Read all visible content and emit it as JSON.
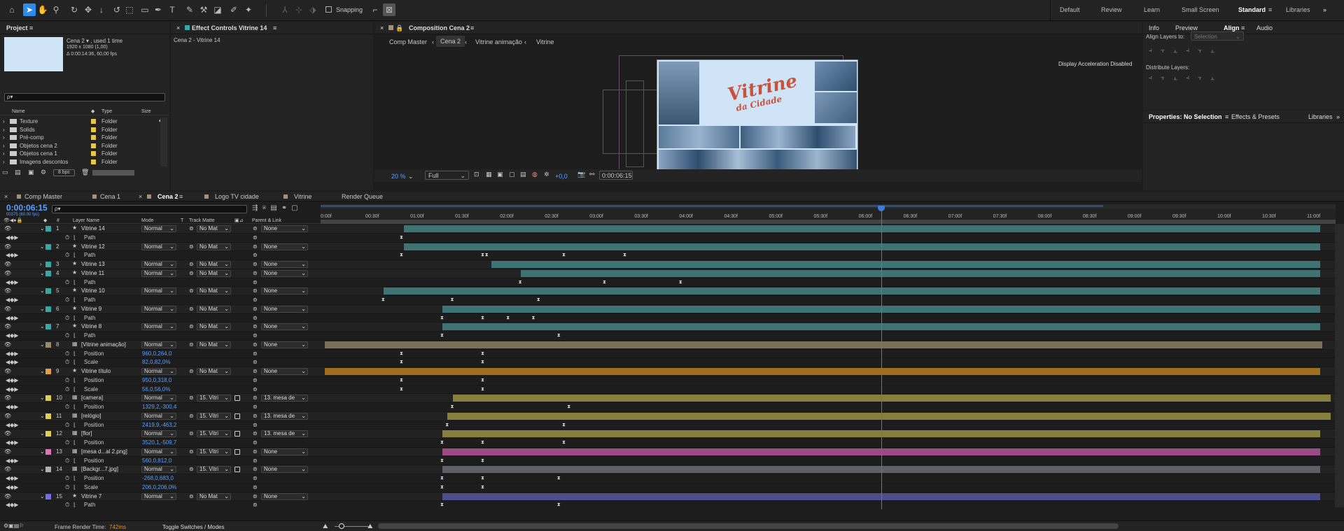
{
  "toolbar": {
    "snapping_label": "Snapping",
    "workspaces": [
      "Default",
      "Review",
      "Learn",
      "Small Screen",
      "Standard",
      "Libraries"
    ],
    "active_workspace": "Standard"
  },
  "project": {
    "title": "Project",
    "comp_name": "Cena 2 ▾ , used 1 time",
    "comp_size": "1920 x 1080 (1,00)",
    "comp_duration": "Δ 0:00:14:36, 60,00 fps",
    "search_placeholder": "ρ▾",
    "columns": [
      "Name",
      "Type",
      "Size"
    ],
    "items": [
      {
        "name": "Texture",
        "type": "Folder"
      },
      {
        "name": "Solids",
        "type": "Folder"
      },
      {
        "name": "Pré-comp",
        "type": "Folder"
      },
      {
        "name": "Objetos cena 2",
        "type": "Folder"
      },
      {
        "name": "Objetos cena 1",
        "type": "Folder"
      },
      {
        "name": "Imagens descontos",
        "type": "Folder"
      }
    ],
    "bpc": "8 bpc"
  },
  "effect_controls": {
    "title": "Effect Controls Vitrine 14",
    "subtitle": "Cena 2 - Vitrine 14"
  },
  "composition": {
    "title": "Composition Cena 2",
    "breadcrumbs": [
      "Comp Master",
      "Cena 2",
      "Vitrine animação",
      "Vitrine"
    ],
    "active_breadcrumb": "Cena 2",
    "display_msg": "Display Acceleration Disabled",
    "zoom": "20 %",
    "resolution": "Full",
    "exposure": "+0,0",
    "timecode": "0:00:06:15",
    "art_title": "Vitrine",
    "art_sub": "da Cidade"
  },
  "right": {
    "tabs": [
      "Info",
      "Preview",
      "Align",
      "Audio"
    ],
    "active_tab": "Align",
    "align_to_label": "Align Layers to:",
    "align_to_value": "Selection",
    "distribute_label": "Distribute Layers:",
    "props_tabs": [
      "Properties: No Selection",
      "Effects & Presets",
      "Libraries"
    ]
  },
  "timeline": {
    "tabs": [
      "Comp Master",
      "Cena 1",
      "Cena 2",
      "Logo TV cidade",
      "Vitrine",
      "Render Queue"
    ],
    "active_tab": "Cena 2",
    "timecode": "0:00:06:15",
    "frame_info": "00375 (60.00 fps)",
    "search_placeholder": "ρ▾",
    "col_headers": {
      "num": "#",
      "layer": "Layer Name",
      "mode": "Mode",
      "t": "T",
      "matte": "Track Matte",
      "parent": "Parent & Link"
    },
    "ruler": [
      "0:00f",
      "00:30f",
      "01:00f",
      "01:30f",
      "02:00f",
      "02:30f",
      "03:00f",
      "03:30f",
      "04:00f",
      "04:30f",
      "05:00f",
      "05:30f",
      "06:00f",
      "06:30f",
      "07:00f",
      "07:30f",
      "08:00f",
      "08:30f",
      "09:00f",
      "09:30f",
      "10:00f",
      "10:30f",
      "11:00f"
    ],
    "footer_render_label": "Frame Render Time:",
    "footer_render_value": "742ms",
    "footer_toggle": "Toggle Switches / Modes",
    "rows": [
      {
        "n": "1",
        "name": "Vitrine 14",
        "kind": "layer",
        "icon": "★",
        "color": "#3aa6a6",
        "mode": "Normal",
        "matte": "No Mat",
        "parent": "None",
        "bar": "#3f7272",
        "bs": 0.082,
        "be": 0.985
      },
      {
        "name": "Path",
        "kind": "prop",
        "value": "",
        "kf": [
          0.08
        ]
      },
      {
        "n": "2",
        "name": "Vitrine 12",
        "kind": "layer",
        "icon": "★",
        "color": "#3aa6a6",
        "mode": "Normal",
        "matte": "No Mat",
        "parent": "None",
        "bar": "#3f7272",
        "bs": 0.082,
        "be": 0.985
      },
      {
        "name": "Path",
        "kind": "prop",
        "value": "",
        "kf": [
          0.08,
          0.16,
          0.164,
          0.24,
          0.3
        ]
      },
      {
        "n": "3",
        "name": "Vitrine 13",
        "kind": "layer",
        "icon": "★",
        "color": "#3aa6a6",
        "mode": "Normal",
        "matte": "No Mat",
        "parent": "None",
        "bar": "#3f7272",
        "bs": 0.168,
        "be": 0.985,
        "collapsed": true
      },
      {
        "n": "4",
        "name": "Vitrine 11",
        "kind": "layer",
        "icon": "★",
        "color": "#3aa6a6",
        "mode": "Normal",
        "matte": "No Mat",
        "parent": "None",
        "bar": "#3f7272",
        "bs": 0.197,
        "be": 0.985
      },
      {
        "name": "Path",
        "kind": "prop",
        "value": "",
        "kf": [
          0.197,
          0.28,
          0.355
        ]
      },
      {
        "n": "5",
        "name": "Vitrine 10",
        "kind": "layer",
        "icon": "★",
        "color": "#3aa6a6",
        "mode": "Normal",
        "matte": "No Mat",
        "parent": "None",
        "bar": "#3f7272",
        "bs": 0.062,
        "be": 0.985
      },
      {
        "name": "Path",
        "kind": "prop",
        "value": "",
        "kf": [
          0.062,
          0.13,
          0.215
        ]
      },
      {
        "n": "6",
        "name": "Vitrine 9",
        "kind": "layer",
        "icon": "★",
        "color": "#3aa6a6",
        "mode": "Normal",
        "matte": "No Mat",
        "parent": "None",
        "bar": "#3f7272",
        "bs": 0.12,
        "be": 0.985
      },
      {
        "name": "Path",
        "kind": "prop",
        "value": "",
        "kf": [
          0.12,
          0.16,
          0.185,
          0.21
        ]
      },
      {
        "n": "7",
        "name": "Vitrine 8",
        "kind": "layer",
        "icon": "★",
        "color": "#3aa6a6",
        "mode": "Normal",
        "matte": "No Mat",
        "parent": "None",
        "bar": "#3f7272",
        "bs": 0.12,
        "be": 0.985
      },
      {
        "name": "Path",
        "kind": "prop",
        "value": "",
        "kf": [
          0.12,
          0.235
        ]
      },
      {
        "n": "8",
        "name": "[Vitrine animação]",
        "kind": "layer",
        "icon": "▦",
        "color": "#9c8a66",
        "mode": "Normal",
        "matte": "No Mat",
        "parent": "None",
        "bar": "#7b6f58",
        "bs": 0.004,
        "be": 0.987
      },
      {
        "name": "Position",
        "kind": "prop",
        "value": "960,0,264,0",
        "kf": [
          0.08,
          0.16
        ]
      },
      {
        "name": "Scale",
        "kind": "prop",
        "value": "82,0,82,0%",
        "kf": [
          0.08,
          0.16
        ]
      },
      {
        "n": "9",
        "name": "Vitrine título",
        "kind": "layer",
        "icon": "★",
        "color": "#e0a04a",
        "mode": "Normal",
        "matte": "No Mat",
        "parent": "None",
        "bar": "#a06f1e",
        "bs": 0.004,
        "be": 0.985
      },
      {
        "name": "Position",
        "kind": "prop",
        "value": "950,0,318,0",
        "kf": [
          0.08,
          0.16
        ]
      },
      {
        "name": "Scale",
        "kind": "prop",
        "value": "56,0,56,0%",
        "kf": [
          0.08,
          0.16
        ]
      },
      {
        "n": "10",
        "name": "[camera]",
        "kind": "layer",
        "icon": "▦",
        "color": "#e0d050",
        "mode": "Normal",
        "matte": "15. Vitri",
        "parent": "13. mesa de",
        "bar": "#87803d",
        "bs": 0.13,
        "be": 0.995
      },
      {
        "name": "Position",
        "kind": "prop",
        "value": "1329,2,-300,4",
        "kf": [
          0.13,
          0.245
        ]
      },
      {
        "n": "11",
        "name": "[relógio]",
        "kind": "layer",
        "icon": "▦",
        "color": "#e0d050",
        "mode": "Normal",
        "matte": "15. Vitri",
        "parent": "13. mesa de",
        "bar": "#87803d",
        "bs": 0.125,
        "be": 0.995
      },
      {
        "name": "Position",
        "kind": "prop",
        "value": "2419,9,-463,2",
        "kf": [
          0.125,
          0.24
        ]
      },
      {
        "n": "12",
        "name": "[flor]",
        "kind": "layer",
        "icon": "▦",
        "color": "#e0d050",
        "mode": "Normal",
        "matte": "15. Vitri",
        "parent": "13. mesa de",
        "bar": "#87803d",
        "bs": 0.12,
        "be": 0.985
      },
      {
        "name": "Position",
        "kind": "prop",
        "value": "3520,1,-509,7",
        "kf": [
          0.12,
          0.16,
          0.24
        ]
      },
      {
        "n": "13",
        "name": "[mesa d...al 2.png]",
        "kind": "layer",
        "icon": "▦",
        "color": "#e070c0",
        "mode": "Normal",
        "matte": "15. Vitri",
        "parent": "None",
        "bar": "#9c4a86",
        "bs": 0.12,
        "be": 0.985
      },
      {
        "name": "Position",
        "kind": "prop",
        "value": "560,0,812,0",
        "kf": [
          0.12,
          0.16
        ]
      },
      {
        "n": "14",
        "name": "[Backgr...7.jpg]",
        "kind": "layer",
        "icon": "▦",
        "color": "#b0b0b0",
        "mode": "Normal",
        "matte": "15. Vitri",
        "parent": "None",
        "bar": "#5f5f66",
        "bs": 0.12,
        "be": 0.985
      },
      {
        "name": "Position",
        "kind": "prop",
        "value": "-268,0,683,0",
        "kf": [
          0.12,
          0.16,
          0.235
        ]
      },
      {
        "name": "Scale",
        "kind": "prop",
        "value": "206,0,206,0%",
        "kf": [
          0.12,
          0.16
        ]
      },
      {
        "n": "15",
        "name": "Vitrine 7",
        "kind": "layer",
        "icon": "★",
        "color": "#7070e0",
        "mode": "Normal",
        "matte": "No Mat",
        "parent": "None",
        "bar": "#4e4e8c",
        "bs": 0.12,
        "be": 0.985
      },
      {
        "name": "Path",
        "kind": "prop",
        "value": "",
        "kf": [
          0.12,
          0.235
        ]
      }
    ]
  }
}
